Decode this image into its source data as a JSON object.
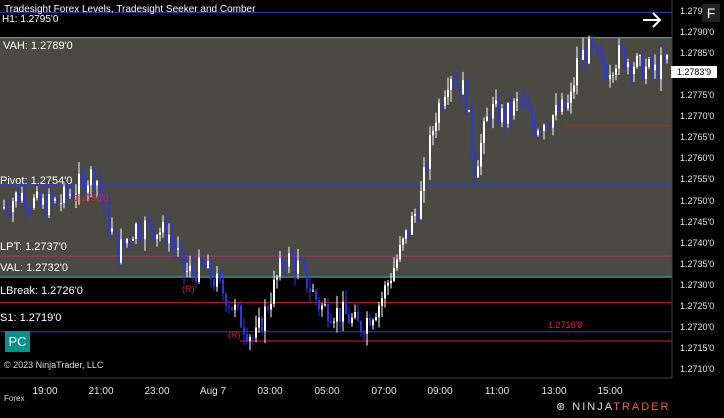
{
  "title": "Tradesight Forex Levels, Tradesight Seeker and Comber",
  "overlay_label": "H1: 1.2795'0",
  "levels": [
    {
      "name": "VAH",
      "label": "VAH: 1.2789'0",
      "value": 1.2789,
      "color": "#28c8c8",
      "shade_from": true
    },
    {
      "name": "Pivot",
      "label": "Pivot: 1.2754'0",
      "value": 1.2754,
      "color": "#2a3ad8"
    },
    {
      "name": "LPT",
      "label": "LPT: 1.2737'0",
      "value": 1.2737,
      "color": "#b0306a"
    },
    {
      "name": "VAL",
      "label": "VAL: 1.2732'0",
      "value": 1.2732,
      "color": "#28c8c8"
    },
    {
      "name": "LBreak",
      "label": "LBreak: 1.2726'0",
      "value": 1.2726,
      "color": "#c81e1e"
    },
    {
      "name": "S1",
      "label": "S1: 1.2719'0",
      "value": 1.2719,
      "color": "#2a3ad8"
    }
  ],
  "annotations": [
    {
      "text": "1.2716'8",
      "value": 1.27168,
      "color": "#e0203a"
    },
    {
      "text": "1.2750'0",
      "value": 1.275,
      "color": "#e0203a"
    }
  ],
  "y_axis_ticks": [
    "1.2795'0",
    "1.2790'0",
    "1.2785'0",
    "1.2780'0",
    "1.2775'0",
    "1.2770'0",
    "1.2765'0",
    "1.2760'0",
    "1.2755'0",
    "1.2750'0",
    "1.2745'0",
    "1.2740'0",
    "1.2735'0",
    "1.2730'0",
    "1.2725'0",
    "1.2720'0",
    "1.2715'0",
    "1.2710'0"
  ],
  "x_axis_ticks": [
    "19:00",
    "21:00",
    "23:00",
    "Aug 7",
    "03:00",
    "05:00",
    "07:00",
    "09:00",
    "11:00",
    "13:00",
    "15:00"
  ],
  "current_price": "1.2783'9",
  "pc_button": "PC",
  "f_button": "F",
  "copyright": "© 2023 NinjaTrader, LLC",
  "instrument_class": "Forex",
  "logo_prefix": "NINJA",
  "logo_accent": "TRADER",
  "signal_markers": [
    {
      "text": "(R)",
      "color": "#e0203a"
    },
    {
      "text": "(R)",
      "color": "#e0203a"
    }
  ],
  "colors": {
    "bg": "#000000",
    "value_area": "#4a4a42",
    "candle_up": "#ffffff",
    "candle_down": "#2a36e0"
  }
}
